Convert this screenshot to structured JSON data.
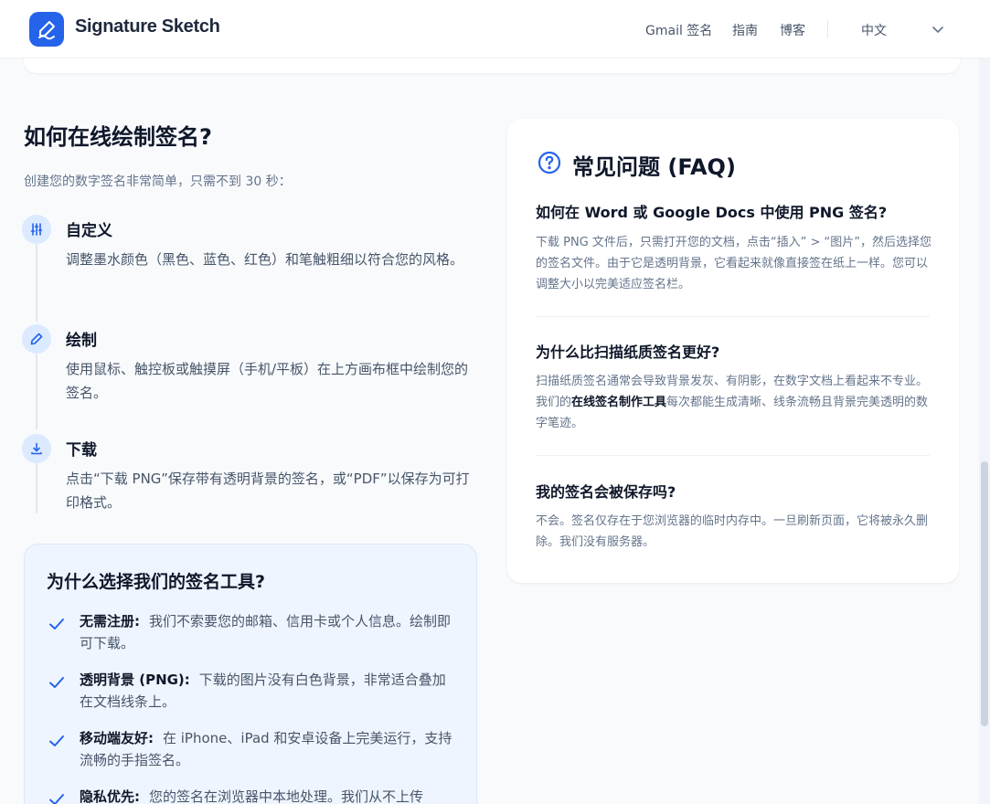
{
  "header": {
    "brand": "Signature Sketch",
    "nav": [
      "Gmail 签名",
      "指南",
      "博客"
    ],
    "language": "中文",
    "accent": "#2563eb"
  },
  "howto": {
    "title": "如何在线绘制签名?",
    "intro": "创建您的数字签名非常简单，只需不到 30 秒：",
    "steps": [
      {
        "icon": "sliders-icon",
        "title": "自定义",
        "desc": "调整墨水颜色（黑色、蓝色、红色）和笔触粗细以符合您的风格。"
      },
      {
        "icon": "pencil-icon",
        "title": "绘制",
        "desc": "使用鼠标、触控板或触摸屏（手机/平板）在上方画布框中绘制您的签名。"
      },
      {
        "icon": "download-icon",
        "title": "下载",
        "desc": "点击“下载 PNG”保存带有透明背景的签名，或“PDF”以保存为可打印格式。"
      }
    ]
  },
  "why": {
    "title": "为什么选择我们的签名工具?",
    "items": [
      {
        "label": "无需注册:",
        "text": "我们不索要您的邮箱、信用卡或个人信息。绘制即可下载。"
      },
      {
        "label": "透明背景 (PNG):",
        "text": "下载的图片没有白色背景，非常适合叠加在文档线条上。"
      },
      {
        "label": "移动端友好:",
        "text": "在 iPhone、iPad 和安卓设备上完美运行，支持流畅的手指签名。"
      },
      {
        "label": "隐私优先:",
        "text": "您的签名在浏览器中本地处理。我们从不上传"
      }
    ]
  },
  "faq": {
    "title": "常见问题 (FAQ)",
    "items": [
      {
        "q": "如何在 Word 或 Google Docs 中使用 PNG 签名?",
        "a": "下载 PNG 文件后，只需打开您的文档，点击“插入” > “图片”，然后选择您的签名文件。由于它是透明背景，它看起来就像直接签在纸上一样。您可以调整大小以完美适应签名栏。"
      },
      {
        "q": "为什么比扫描纸质签名更好?",
        "a_pre": "扫描纸质签名通常会导致背景发灰、有阴影，在数字文档上看起来不专业。我们的",
        "a_bold": "在线签名制作工具",
        "a_post": "每次都能生成清晰、线条流畅且背景完美透明的数字笔迹。"
      },
      {
        "q": "我的签名会被保存吗?",
        "a": "不会。签名仅存在于您浏览器的临时内存中。一旦刷新页面，它将被永久删除。我们没有服务器。"
      }
    ]
  }
}
